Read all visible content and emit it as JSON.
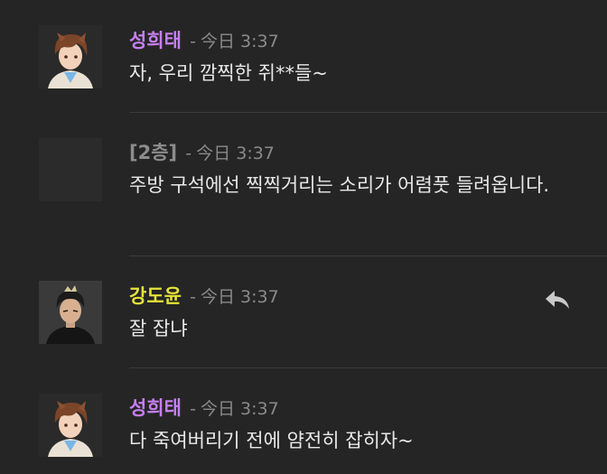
{
  "messages": [
    {
      "author": "성희태",
      "author_color": "#c57ff0",
      "separator": "-",
      "time": "今日 3:37",
      "text": "자, 우리 깜찍한 쥐**들~",
      "avatar_icon": "brown-haired-character-avatar"
    },
    {
      "author": "[2층]",
      "author_color": "#8c8c8c",
      "separator": "-",
      "time": "今日 3:37",
      "text": "주방 구석에선 찍찍거리는 소리가 어렴풋 들려옵니다.",
      "avatar_icon": "blank-dark-avatar"
    },
    {
      "author": "강도윤",
      "author_color": "#e6e23a",
      "separator": "-",
      "time": "今日 3:37",
      "text": "잘 잡냐",
      "avatar_icon": "dark-haired-character-avatar",
      "action_icon": "reply-icon"
    },
    {
      "author": "성희태",
      "author_color": "#c57ff0",
      "separator": "-",
      "time": "今日 3:37",
      "text": "다 죽여버리기 전에 얌전히 잡히자~",
      "avatar_icon": "brown-haired-character-avatar"
    }
  ]
}
